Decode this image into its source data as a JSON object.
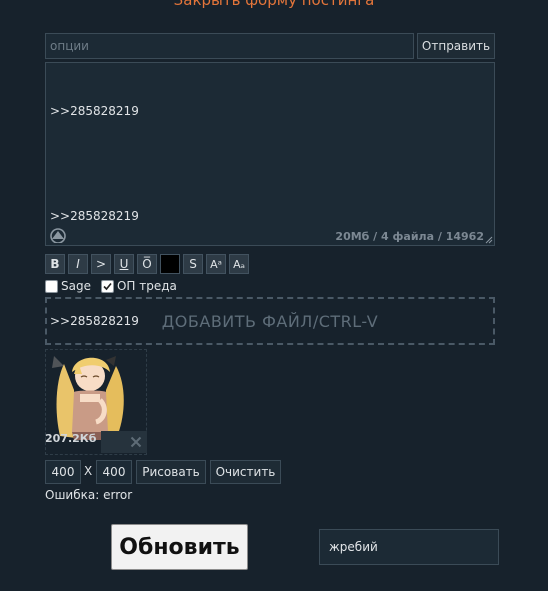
{
  "form": {
    "close_link": "Закрыть форму постинга",
    "options_placeholder": "опции",
    "send_label": "Отправить",
    "message_lines": [
      ">>285828219",
      "",
      ">>285828219",
      "",
      ">>285828219"
    ],
    "limits": "20Мб / 4 файла / 14962"
  },
  "markup": {
    "buttons": [
      "B",
      "I",
      ">",
      "U",
      "O̅",
      "█",
      "S",
      "Aᵃ",
      "Aₐ"
    ]
  },
  "checkboxes": {
    "sage_label": "Sage",
    "sage_checked": false,
    "op_label": "ОП треда",
    "op_checked": true
  },
  "dropzone": {
    "label": "ДОБАВИТЬ ФАЙЛ/CTRL-V"
  },
  "attachment": {
    "size": "207.2Кб",
    "remove_icon": "close-icon"
  },
  "drawing": {
    "width_value": "400",
    "x_label": "X",
    "height_value": "400",
    "draw_label": "Рисовать",
    "clear_label": "Очистить",
    "error": "Ошибка: error"
  },
  "bottom": {
    "refresh_label": "Обновить",
    "lot_value": "жребий"
  },
  "colors": {
    "background": "#17222c",
    "accent": "#e3753a",
    "field_bg": "#1c2a35",
    "border": "#3b4b57"
  }
}
